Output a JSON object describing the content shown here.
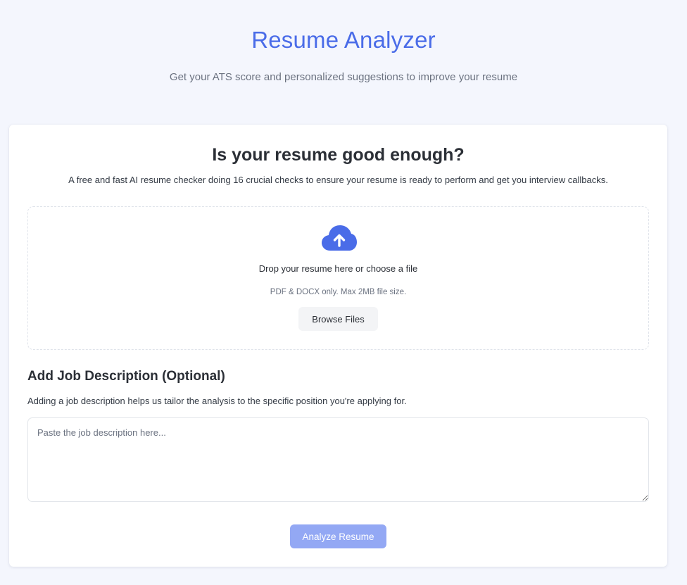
{
  "header": {
    "title": "Resume Analyzer",
    "subtitle": "Get your ATS score and personalized suggestions to improve your resume"
  },
  "card": {
    "title": "Is your resume good enough?",
    "description": "A free and fast AI resume checker doing 16 crucial checks to ensure your resume is ready to perform and get you interview callbacks."
  },
  "upload": {
    "icon": "cloud-upload-icon",
    "drop_text": "Drop your resume here or choose a file",
    "hint": "PDF & DOCX only. Max 2MB file size.",
    "browse_label": "Browse Files"
  },
  "job_description": {
    "title": "Add Job Description (Optional)",
    "description": "Adding a job description helps us tailor the analysis to the specific position you're applying for.",
    "placeholder": "Paste the job description here...",
    "value": ""
  },
  "actions": {
    "analyze_label": "Analyze Resume",
    "analyze_enabled": false
  },
  "colors": {
    "accent": "#4a6ce8",
    "accent_disabled": "#93a8f4",
    "background": "#f4f6fd"
  }
}
